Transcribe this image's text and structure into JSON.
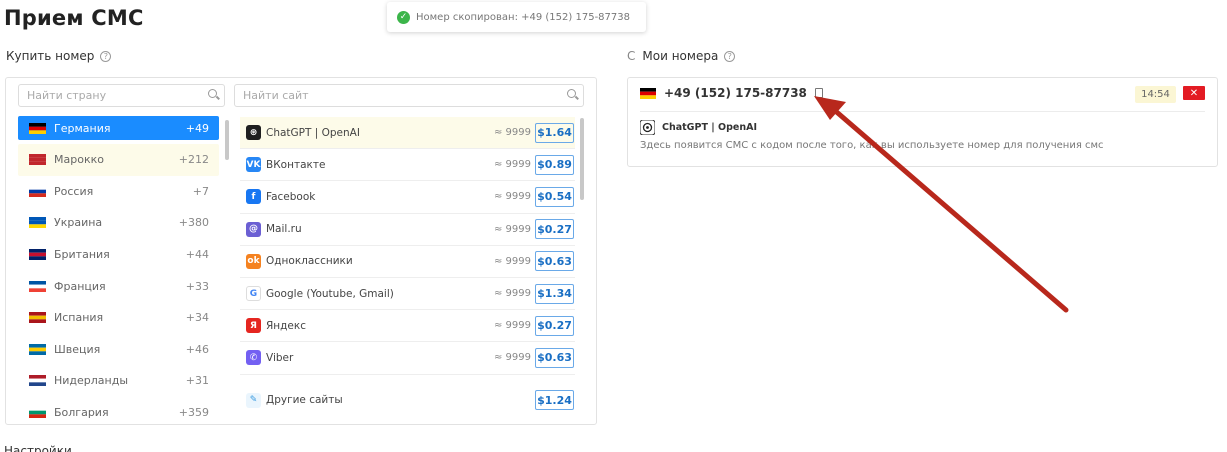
{
  "page": {
    "title": "Прием СМС",
    "settings_label": "Настройки"
  },
  "toast": {
    "text": "Номер скопирован: +49 (152) 175-87738"
  },
  "buy": {
    "heading": "Купить номер",
    "help": "?",
    "country_search_placeholder": "Найти страну",
    "site_search_placeholder": "Найти сайт",
    "countries": [
      {
        "name": "Германия",
        "code": "+49",
        "flag": [
          "#000000",
          "#dd0000",
          "#ffce00"
        ],
        "state": "active"
      },
      {
        "name": "Марокко",
        "code": "+212",
        "flag": [
          "#c1272d",
          "#c1272d",
          "#c1272d"
        ],
        "state": "hover"
      },
      {
        "name": "Россия",
        "code": "+7",
        "flag": [
          "#ffffff",
          "#0039a6",
          "#d52b1e"
        ],
        "state": ""
      },
      {
        "name": "Украина",
        "code": "+380",
        "flag": [
          "#0057b7",
          "#0057b7",
          "#ffd700"
        ],
        "state": ""
      },
      {
        "name": "Британия",
        "code": "+44",
        "flag": [
          "#012169",
          "#c8102e",
          "#012169"
        ],
        "state": ""
      },
      {
        "name": "Франция",
        "code": "+33",
        "flag": [
          "#0055a4",
          "#ffffff",
          "#ef4135"
        ],
        "state": ""
      },
      {
        "name": "Испания",
        "code": "+34",
        "flag": [
          "#aa151b",
          "#f1bf00",
          "#aa151b"
        ],
        "state": ""
      },
      {
        "name": "Швеция",
        "code": "+46",
        "flag": [
          "#006aa7",
          "#fecc00",
          "#006aa7"
        ],
        "state": ""
      },
      {
        "name": "Нидерланды",
        "code": "+31",
        "flag": [
          "#ae1c28",
          "#ffffff",
          "#21468b"
        ],
        "state": ""
      },
      {
        "name": "Болгария",
        "code": "+359",
        "flag": [
          "#ffffff",
          "#00966e",
          "#d62612"
        ],
        "state": ""
      }
    ],
    "sites": [
      {
        "name": "ChatGPT | OpenAI",
        "qty": "≈ 9999",
        "price": "$1.64",
        "icon": "chatgpt-icon",
        "color": "#1f1f1f",
        "glyph": "⊛",
        "state": "hover"
      },
      {
        "name": "ВКонтакте",
        "qty": "≈ 9999",
        "price": "$0.89",
        "icon": "vk-icon",
        "color": "#2787f5",
        "glyph": "VK",
        "state": ""
      },
      {
        "name": "Facebook",
        "qty": "≈ 9999",
        "price": "$0.54",
        "icon": "facebook-icon",
        "color": "#1877f2",
        "glyph": "f",
        "state": ""
      },
      {
        "name": "Mail.ru",
        "qty": "≈ 9999",
        "price": "$0.27",
        "icon": "mailru-icon",
        "color": "#6b5fd3",
        "glyph": "@",
        "state": ""
      },
      {
        "name": "Одноклассники",
        "qty": "≈ 9999",
        "price": "$0.63",
        "icon": "odnoklassniki-icon",
        "color": "#f58220",
        "glyph": "ok",
        "state": ""
      },
      {
        "name": "Google (Youtube, Gmail)",
        "qty": "≈ 9999",
        "price": "$1.34",
        "icon": "google-icon",
        "color": "#ffffff",
        "glyph": "G",
        "state": ""
      },
      {
        "name": "Яндекс",
        "qty": "≈ 9999",
        "price": "$0.27",
        "icon": "yandex-icon",
        "color": "#e52620",
        "glyph": "Я",
        "state": ""
      },
      {
        "name": "Viber",
        "qty": "≈ 9999",
        "price": "$0.63",
        "icon": "viber-icon",
        "color": "#7360f2",
        "glyph": "✆",
        "state": ""
      }
    ],
    "other": {
      "name": "Другие сайты",
      "price": "$1.24",
      "icon": "other-sites-icon"
    }
  },
  "my_numbers": {
    "heading": "Мои номера",
    "help": "?",
    "refresh": "C",
    "number": "+49 (152) 175-87738",
    "flag": [
      "#000000",
      "#dd0000",
      "#ffce00"
    ],
    "timer": "14:54",
    "close": "✕",
    "service": "ChatGPT | OpenAI",
    "message": "Здесь появится СМС с кодом после того, как вы используете номер для получения смс"
  },
  "colors": {
    "accent": "#1a8cff",
    "annotation_arrow": "#b8281c"
  }
}
